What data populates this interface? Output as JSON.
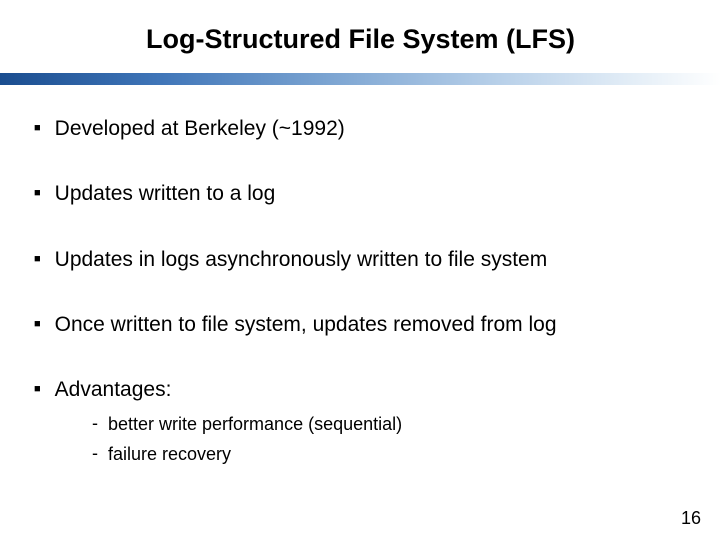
{
  "title": "Log-Structured File System (LFS)",
  "bullets": [
    {
      "text": "Developed at Berkeley (~1992)"
    },
    {
      "text": "Updates written to a log"
    },
    {
      "text": "Updates in logs asynchronously written to file system"
    },
    {
      "text": "Once written to file system, updates removed from log"
    },
    {
      "text": "Advantages:"
    }
  ],
  "subBullets": [
    {
      "text": "better write performance (sequential)"
    },
    {
      "text": "failure recovery"
    }
  ],
  "pageNumber": "16"
}
